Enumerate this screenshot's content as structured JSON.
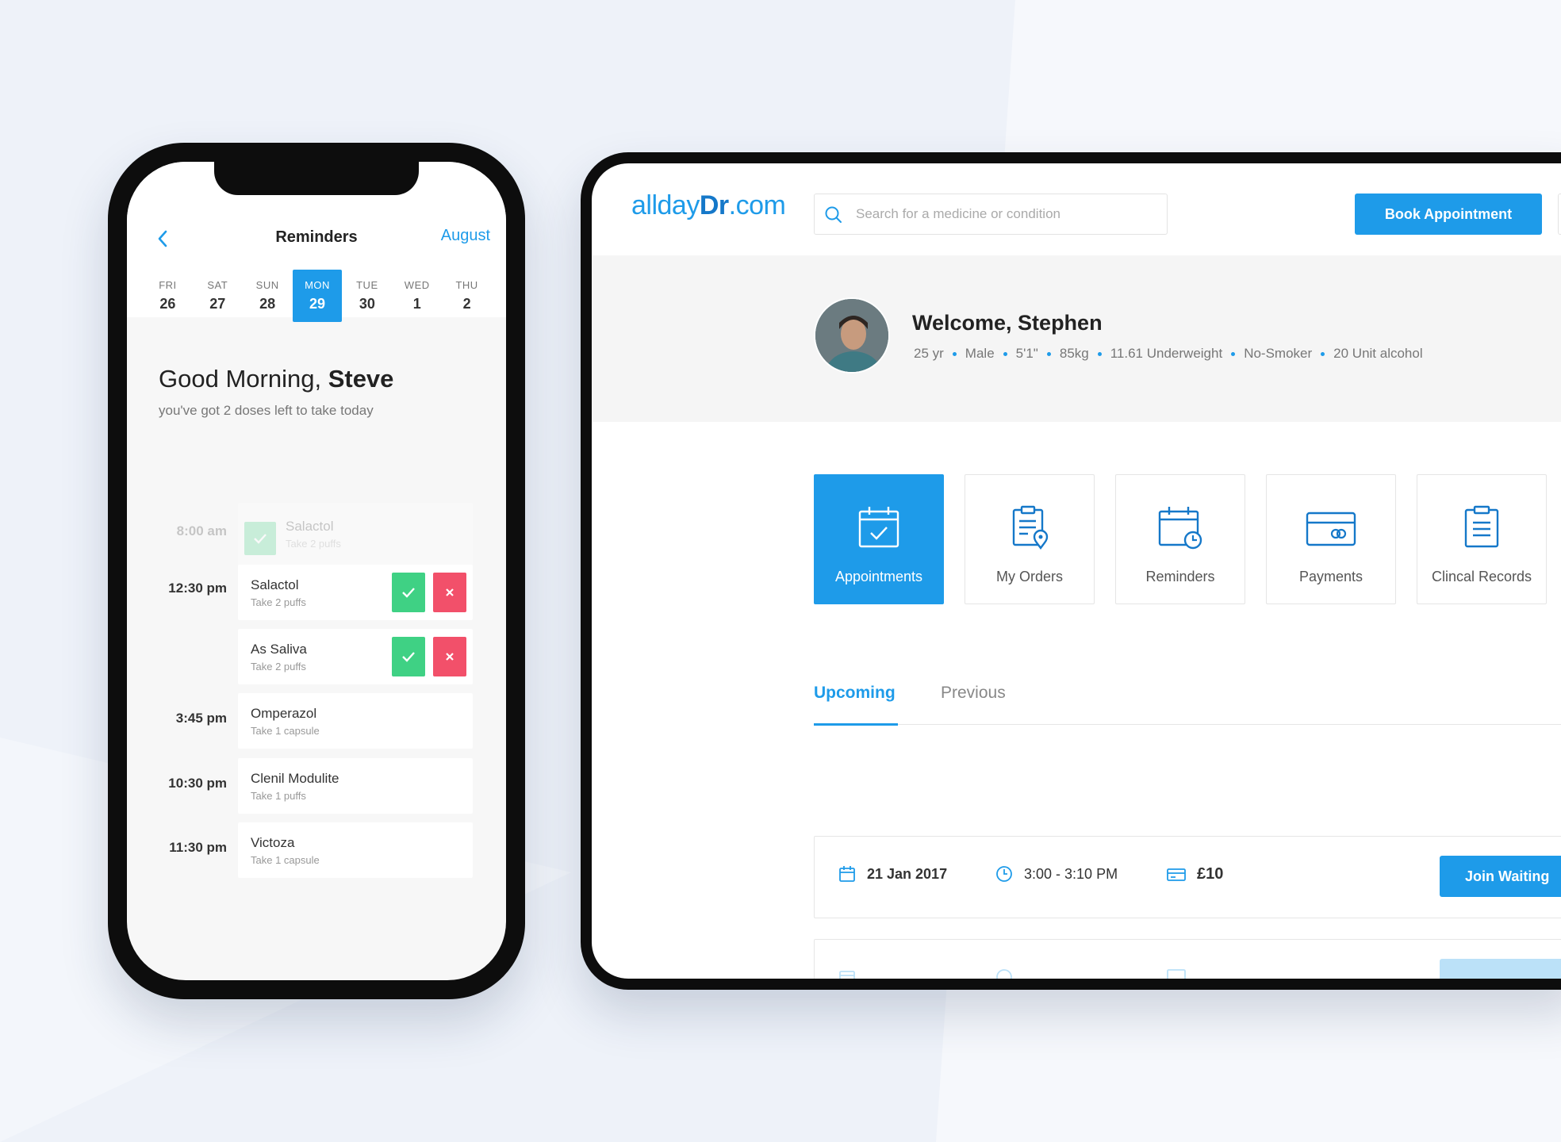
{
  "phone": {
    "title": "Reminders",
    "month": "August",
    "days": [
      {
        "name": "FRI",
        "num": "26"
      },
      {
        "name": "SAT",
        "num": "27"
      },
      {
        "name": "SUN",
        "num": "28"
      },
      {
        "name": "MON",
        "num": "29",
        "active": true
      },
      {
        "name": "TUE",
        "num": "30"
      },
      {
        "name": "WED",
        "num": "1"
      },
      {
        "name": "THU",
        "num": "2"
      }
    ],
    "greeting": "Good Morning,",
    "user_name": "Steve",
    "subtitle": "you've got 2 doses left to take today",
    "reminders": [
      {
        "time": "8:00 am",
        "name": "Salactol",
        "dose": "Take 2 puffs",
        "done": true
      },
      {
        "time": "12:30 pm",
        "name": "Salactol",
        "dose": "Take 2 puffs"
      },
      {
        "time": "",
        "name": "As Saliva",
        "dose": "Take 2 puffs"
      },
      {
        "time": "3:45 pm",
        "name": "Omperazol",
        "dose": "Take 1 capsule"
      },
      {
        "time": "10:30 pm",
        "name": "Clenil Modulite",
        "dose": "Take 1 puffs"
      },
      {
        "time": "11:30 pm",
        "name": "Victoza",
        "dose": "Take 1 capsule"
      }
    ]
  },
  "web": {
    "logo_a": "allday",
    "logo_b": "Dr",
    "logo_c": ".com",
    "search_placeholder": "Search for a medicine or condition",
    "book_label": "Book Appointment",
    "welcome": "Welcome, Stephen",
    "stats": [
      "25 yr",
      "Male",
      "5'1\"",
      "85kg",
      "11.61 Underweight",
      "No-Smoker",
      "20 Unit alcohol"
    ],
    "tiles": [
      {
        "label": "Appointments",
        "icon": "calendar-check-icon"
      },
      {
        "label": "My Orders",
        "icon": "clipboard-pin-icon"
      },
      {
        "label": "Reminders",
        "icon": "calendar-clock-icon"
      },
      {
        "label": "Payments",
        "icon": "card-icon"
      },
      {
        "label": "Clincal Records",
        "icon": "clipboard-icon"
      }
    ],
    "tabs": [
      "Upcoming",
      "Previous"
    ],
    "appointments": [
      {
        "date": "21 Jan 2017",
        "time": "3:00 - 3:10 PM",
        "price": "£10",
        "action": "Join Waiting"
      },
      {
        "date": "",
        "time": "",
        "price": "",
        "action": ""
      }
    ]
  },
  "colors": {
    "accent": "#1e9be9",
    "success": "#3fd184",
    "danger": "#f2506a"
  }
}
